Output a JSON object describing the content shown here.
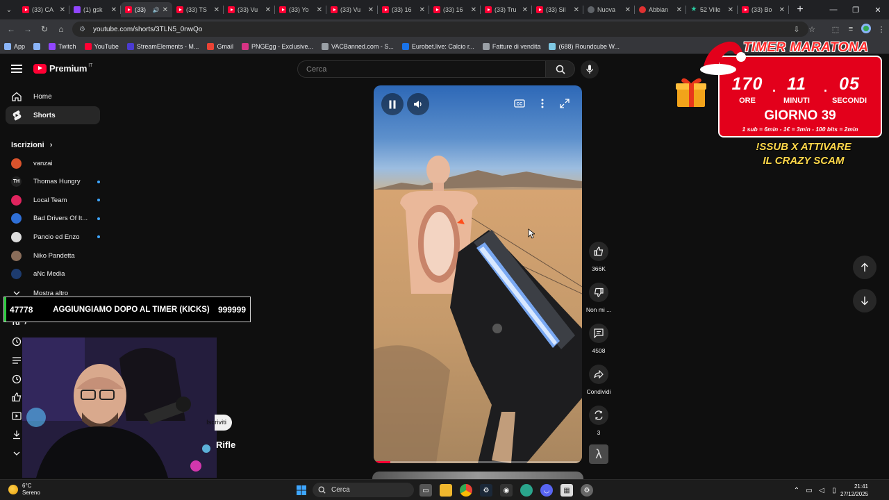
{
  "browser": {
    "tabs": [
      {
        "label": "(33) CA",
        "icon": "yt",
        "active": false
      },
      {
        "label": "(1) gsk",
        "icon": "twitch",
        "active": false
      },
      {
        "label": "(33)",
        "icon": "yt",
        "active": true,
        "audio": true
      },
      {
        "label": "(33) TS",
        "icon": "yt",
        "active": false
      },
      {
        "label": "(33) Vu",
        "icon": "yt",
        "active": false
      },
      {
        "label": "(33) Yo",
        "icon": "yt",
        "active": false
      },
      {
        "label": "(33) Vu",
        "icon": "yt",
        "active": false
      },
      {
        "label": "(33) 16",
        "icon": "yt",
        "active": false
      },
      {
        "label": "(33) 16",
        "icon": "yt",
        "active": false
      },
      {
        "label": "(33) Tru",
        "icon": "yt",
        "active": false
      },
      {
        "label": "(33) Sil",
        "icon": "yt",
        "active": false
      },
      {
        "label": "Nuova",
        "icon": "new",
        "active": false
      },
      {
        "label": "Abbian",
        "icon": "red",
        "active": false
      },
      {
        "label": "52 Ville",
        "icon": "star",
        "active": false
      },
      {
        "label": "(33) Bo",
        "icon": "yt",
        "active": false
      }
    ],
    "url": "youtube.com/shorts/3TLN5_0nwQo",
    "bookmarks": [
      {
        "label": "App",
        "color": "#8ab4f8"
      },
      {
        "label": "",
        "color": "#8ab4f8"
      },
      {
        "label": "Twitch",
        "color": "#9146ff"
      },
      {
        "label": "YouTube",
        "color": "#ff0033"
      },
      {
        "label": "StreamElements - M...",
        "color": "#4b3bd1"
      },
      {
        "label": "Gmail",
        "color": "#ea4335"
      },
      {
        "label": "PNGEgg - Exclusive...",
        "color": "#d63384"
      },
      {
        "label": "VACBanned.com - S...",
        "color": "#9aa0a6"
      },
      {
        "label": "Eurobet.live: Calcio r...",
        "color": "#1a73e8"
      },
      {
        "label": "Fatture di vendita",
        "color": "#9aa0a6"
      },
      {
        "label": "(688) Roundcube W...",
        "color": "#7ec8e3"
      }
    ]
  },
  "youtube": {
    "logo_text": "Premium",
    "logo_country": "IT",
    "search_placeholder": "Cerca",
    "nav": [
      {
        "label": "Home",
        "icon": "home-icon",
        "active": false
      },
      {
        "label": "Shorts",
        "icon": "shorts-icon",
        "active": true
      }
    ],
    "subscriptions_heading": "Iscrizioni",
    "subscriptions": [
      {
        "name": "vanzai",
        "color": "#d9532c",
        "initials": "",
        "live": false
      },
      {
        "name": "Thomas Hungry",
        "color": "#222222",
        "initials": "TH",
        "live": true
      },
      {
        "name": "Local Team",
        "color": "#e0245e",
        "initials": "",
        "live": true
      },
      {
        "name": "Bad Drivers Of It...",
        "color": "#2f6fd6",
        "initials": "",
        "live": true
      },
      {
        "name": "Pancio ed Enzo",
        "color": "#dddddd",
        "initials": "",
        "live": true
      },
      {
        "name": "Niko Pandetta",
        "color": "#8a6d5a",
        "initials": "",
        "live": false
      },
      {
        "name": "aNc Media",
        "color": "#1d3b6e",
        "initials": "",
        "live": false
      }
    ],
    "show_more": "Mostra altro",
    "you_fragment": "Tu",
    "actions": {
      "likes": "366K",
      "dislike": "Non mi ...",
      "comments": "4508",
      "share": "Condividi",
      "remix": "3"
    },
    "video_progress": 0.08
  },
  "overlay": {
    "goal_current": "47778",
    "goal_title": "AGGIUNGIAMO DOPO AL TIMER (KICKS)",
    "goal_target": "999999",
    "subscribe_fragment": "Iscriviti",
    "video_title_fragment": "Rifle",
    "timer": {
      "title": "TIMER MARATONA",
      "hours": "170",
      "minutes": "11",
      "seconds": "05",
      "hours_label": "ORE",
      "minutes_label": "MINUTI",
      "seconds_label": "SECONDI",
      "day": "GIORNO 39",
      "rules": "1 sub = 6min - 1€ = 3min - 100 bits = 2min"
    },
    "promo": "!SSUB X ATTIVARE IL CRAZY SCAM"
  },
  "taskbar": {
    "weather_temp": "6°C",
    "weather_desc": "Sereno",
    "search_label": "Cerca",
    "time": "21:41",
    "date": "27/12/2025"
  }
}
